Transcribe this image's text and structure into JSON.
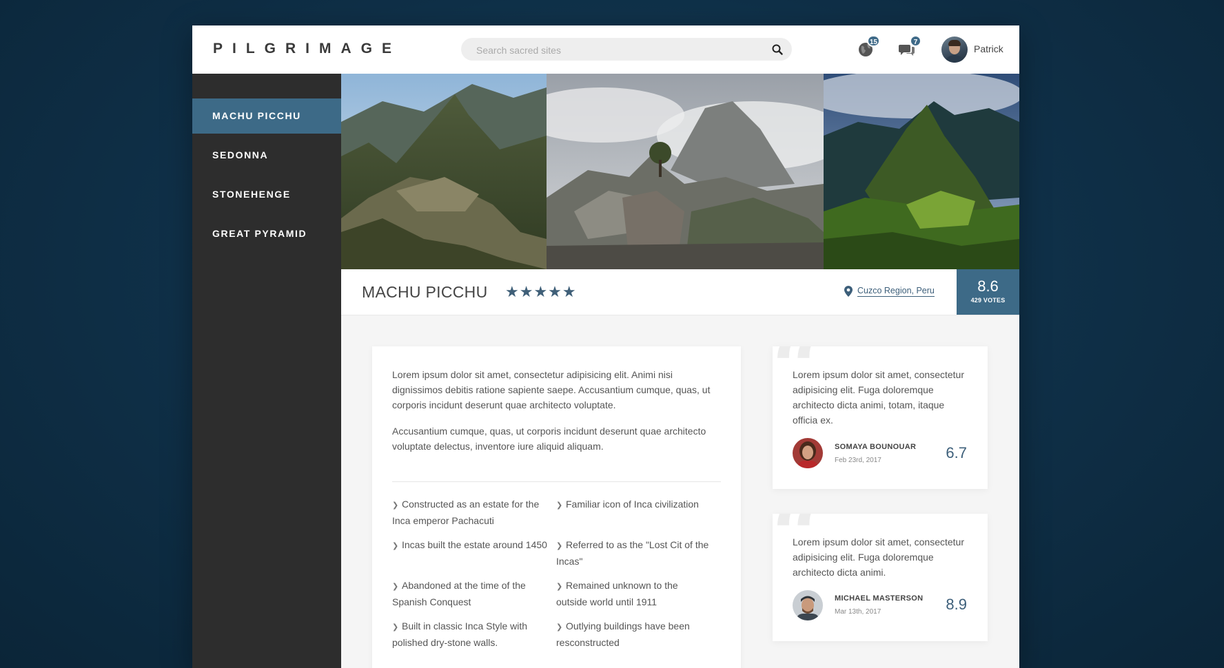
{
  "header": {
    "logo": "PILGRIMAGE",
    "search_placeholder": "Search sacred sites",
    "notifications": [
      {
        "icon": "globe-icon",
        "count": "15"
      },
      {
        "icon": "chat-icon",
        "count": "7"
      }
    ],
    "user_name": "Patrick"
  },
  "sidebar": {
    "items": [
      {
        "label": "MACHU PICCHU",
        "active": true
      },
      {
        "label": "SEDONNA",
        "active": false
      },
      {
        "label": "STONEHENGE",
        "active": false
      },
      {
        "label": "GREAT PYRAMID",
        "active": false
      }
    ]
  },
  "site": {
    "title": "MACHU PICCHU",
    "stars": "★★★★★",
    "rating_stars": 5,
    "location": "Cuzco Region, Peru",
    "score": "8.6",
    "votes": "429 VOTES",
    "description": [
      "Lorem ipsum dolor sit amet, consectetur adipisicing elit. Animi nisi dignissimos debitis ratione sapiente saepe. Accusantium cumque, quas, ut corporis incidunt deserunt quae architecto voluptate.",
      "Accusantium cumque, quas, ut corporis incidunt deserunt quae architecto voluptate delectus, inventore iure aliquid aliquam."
    ],
    "facts": [
      "Constructed as an estate for the Inca emperor Pachacuti",
      "Familiar icon of Inca civilization",
      "Incas built the estate around 1450",
      "Referred to as the \"Lost Cit of the Incas\"",
      "Abandoned at the time of the Spanish Conquest",
      "Remained unknown to the outside world until 1911",
      "Built in classic Inca Style with polished dry-stone walls.",
      "Outlying buildings have been resconstructed"
    ]
  },
  "reviews": [
    {
      "text": "Lorem ipsum dolor sit amet, consectetur adipisicing elit. Fuga doloremque architecto dicta animi, totam, itaque officia ex.",
      "name": "SOMAYA BOUNOUAR",
      "date": "Feb 23rd, 2017",
      "score": "6.7"
    },
    {
      "text": "Lorem ipsum dolor sit amet, consectetur adipisicing elit. Fuga doloremque architecto dicta animi.",
      "name": "MICHAEL MASTERSON",
      "date": "Mar 13th, 2017",
      "score": "8.9"
    }
  ],
  "colors": {
    "accent": "#3d6a87",
    "sidebar_bg": "#2d2d2d",
    "background": "#0f3048"
  }
}
